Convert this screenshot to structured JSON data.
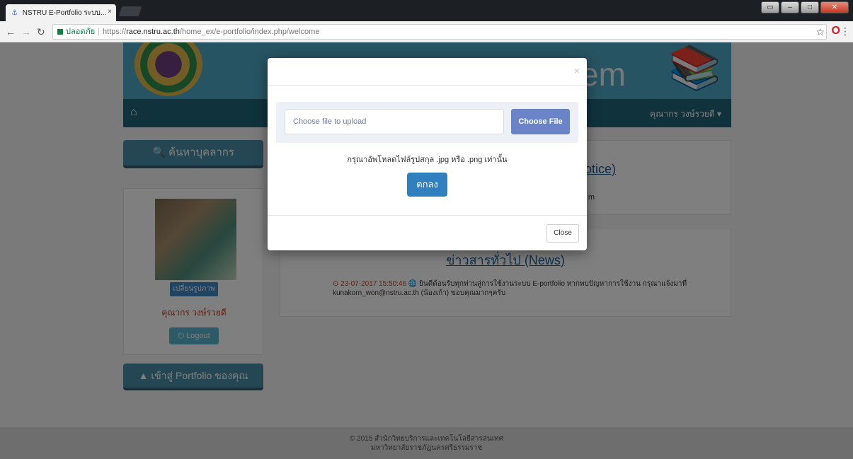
{
  "browser": {
    "tab_title": "NSTRU E-Portfolio ระบบ...",
    "tab_close": "×",
    "secure_label": "ปลอดภัย",
    "url_scheme": "https://",
    "url_host": "race.nstru.ac.th",
    "url_path": "/home_ex/e-portfolio/index.php/welcome"
  },
  "header": {
    "banner_text": "em",
    "user_menu": "คุณากร วงษ์รวยดี ▾"
  },
  "sidebar": {
    "search_label": "ค้นหาบุคลากร",
    "change_photo_label": "เปลี่ยนรูปภาพ",
    "profile_name": "คุณากร วงษ์รวยดี",
    "logout_label": "Logout",
    "portfolio_label": "เข้าสู่ Portfolio ของคุณ"
  },
  "main": {
    "notice_title_fragment": "otice)",
    "notice_text_fragment": "m",
    "news_title": "ข่าวสารทั่วไป (News)",
    "news_date": "23-07-2017 15:50:46",
    "news_body": "ยินดีต้อนรับทุกท่านสู่การใช้งานระบบ E-portfolio หากพบปัญหาการใช้งาน กรุณาแจ้งมาที่ kunakorn_won@nstru.ac.th (น้องเก้า) ขอบคุณมากๆครับ"
  },
  "footer": {
    "line1": "© 2015 สำนักวิทยบริการและเทคโนโลยีสารสนเทศ",
    "line2": "มหาวิทยาลัยราชภัฏนครศรีธรรมราช"
  },
  "modal": {
    "close_x": "×",
    "file_placeholder": "Choose file to upload",
    "choose_button": "Choose File",
    "hint": "กรุณาอัพโหลดไฟล์รูปสกุล .jpg หรือ .png เท่านั้น",
    "ok_button": "ตกลง",
    "close_button": "Close"
  }
}
